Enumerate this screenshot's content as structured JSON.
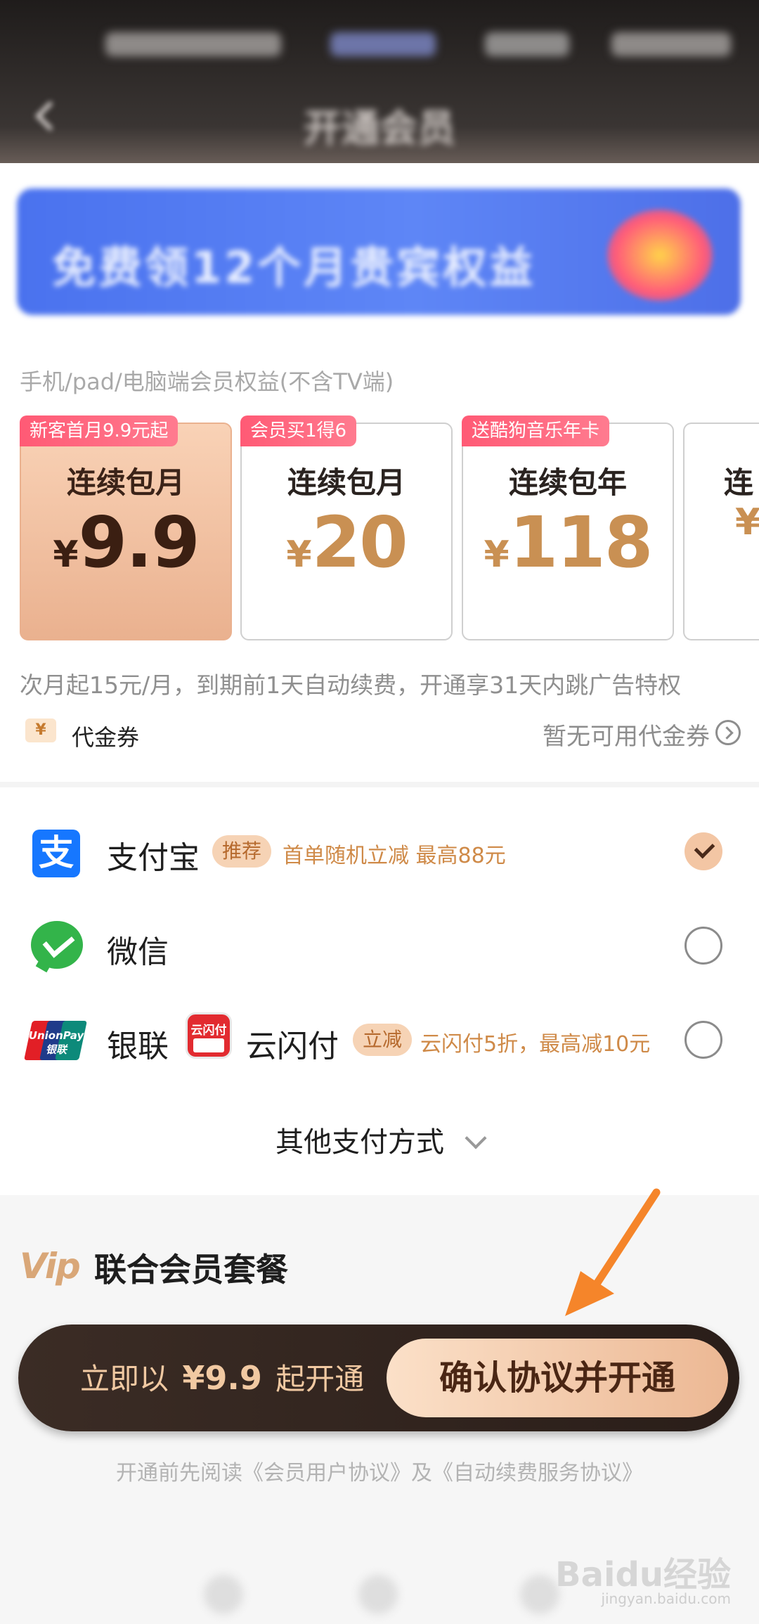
{
  "header": {
    "title": "开通会员"
  },
  "banner": {
    "text": "免费领12个月贵宾权益"
  },
  "rights_note": "手机/pad/电脑端会员权益(不含TV端)",
  "plans": [
    {
      "tag": "新客首月9.9元起",
      "name": "连续包月",
      "currency": "¥",
      "price": "9.9",
      "selected": true
    },
    {
      "tag": "会员买1得6",
      "name": "连续包月",
      "currency": "¥",
      "price": "20",
      "selected": false
    },
    {
      "tag": "送酷狗音乐年卡",
      "name": "连续包年",
      "currency": "¥",
      "price": "118",
      "selected": false
    },
    {
      "tag": "",
      "name": "连",
      "currency": "¥",
      "price": "",
      "selected": false
    }
  ],
  "renew_note": "次月起15元/月，到期前1天自动续费，开通享31天内跳广告特权",
  "voucher": {
    "icon_text": "¥",
    "label": "代金券",
    "status": "暂无可用代金券"
  },
  "payment": {
    "methods": [
      {
        "icon": "alipay-icon",
        "label": "支付宝",
        "badge": "推荐",
        "promo": "首单随机立减 最高88元",
        "selected": true
      },
      {
        "icon": "wechat-icon",
        "label": "微信",
        "badge": "",
        "promo": "",
        "selected": false
      },
      {
        "icon": "unionpay-icon",
        "label": "银联",
        "icon2": "yunshanfu-icon",
        "label2": "云闪付",
        "badge": "立减",
        "promo": "云闪付5折，最高减10元",
        "selected": false
      }
    ],
    "unionpay_logo_text": "UnionPay 银联",
    "yunshanfu_logo_text": "云闪付",
    "other_label": "其他支付方式"
  },
  "vip_section": {
    "logo": "Vip",
    "title": "联合会员套餐"
  },
  "cta": {
    "prefix": "立即以",
    "price": "¥9.9",
    "suffix": "起开通",
    "confirm_label": "确认协议并开通"
  },
  "agreement": "开通前先阅读《会员用户协议》及《自动续费服务协议》",
  "watermark": {
    "text": "Baidu经验",
    "sub": "jingyan.baidu.com"
  },
  "colors": {
    "accent": "#c99053",
    "tag_pink": "#ff5a75",
    "alipay_blue": "#1677ff",
    "wechat_green": "#33b44a",
    "arrow_orange": "#f5852a"
  }
}
